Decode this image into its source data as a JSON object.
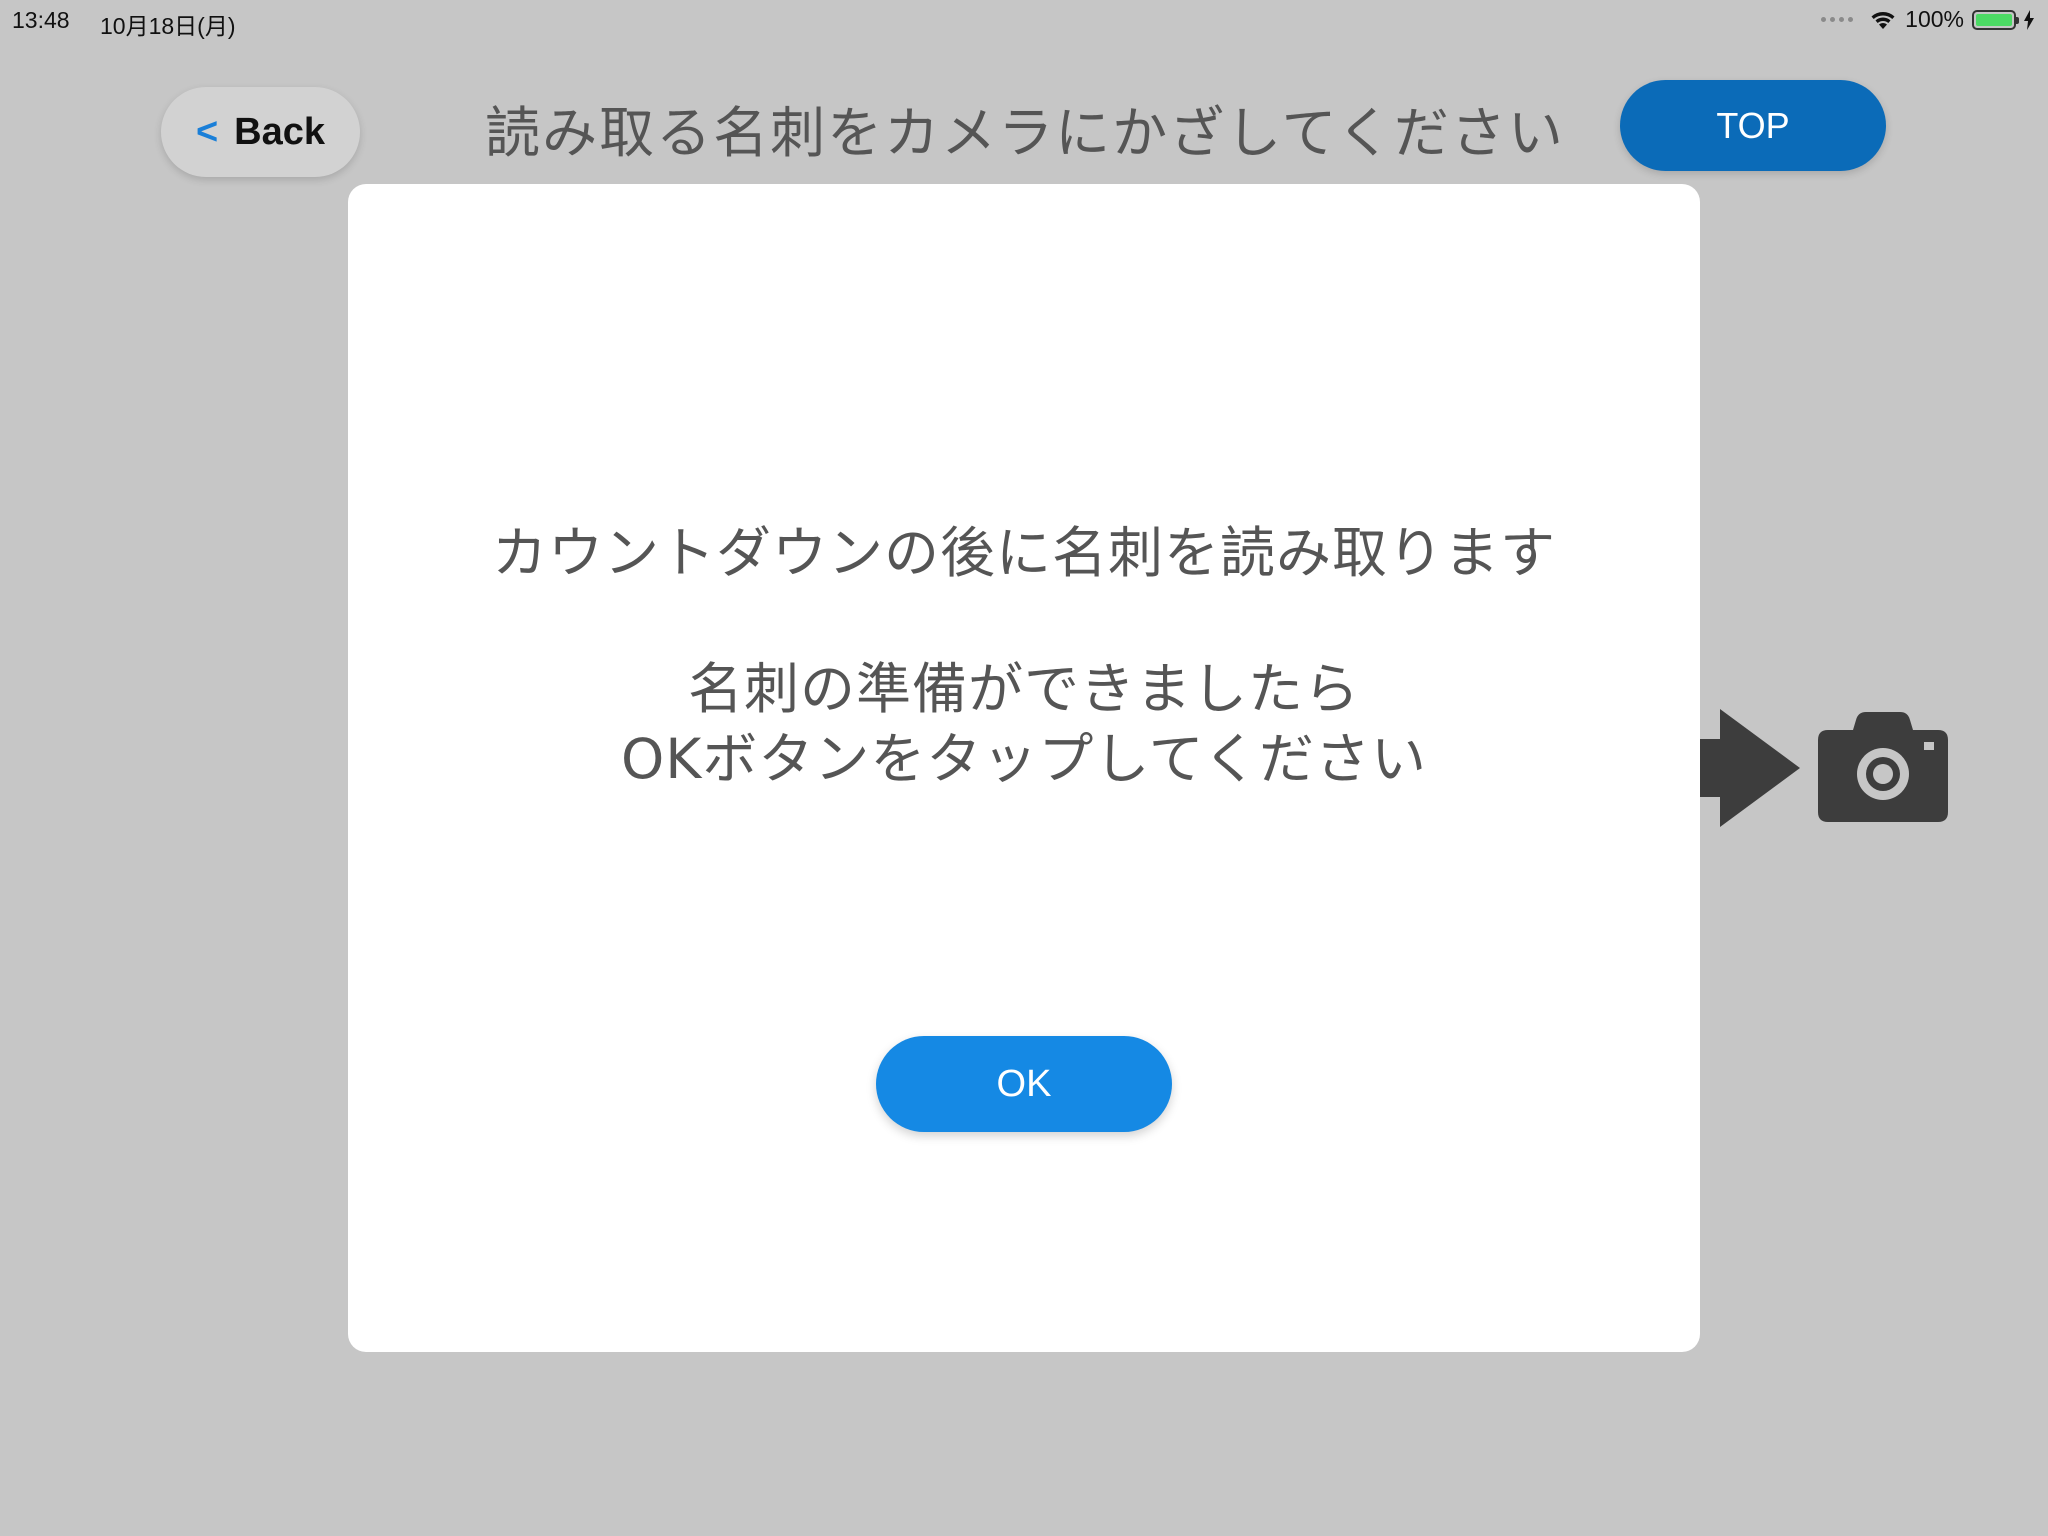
{
  "status_bar": {
    "time": "13:48",
    "date": "10月18日(月)",
    "battery": "100%",
    "battery_fill": 1.0,
    "battery_color": "#4cd964"
  },
  "header": {
    "back_label": "Back",
    "title": "読み取る名刺をカメラにかざしてください",
    "top_label": "TOP"
  },
  "hint_icons": [
    "arrow-right-icon",
    "camera-icon"
  ],
  "dialog": {
    "message": "カウントダウンの後に名刺を読み取ります",
    "instruction_line1": "名刺の準備ができましたら",
    "instruction_line2": "OKボタンをタップしてください",
    "ok_label": "OK"
  },
  "colors": {
    "background": "#c6c6c6",
    "top_button": "#0b6bb8",
    "ok_button": "#1589e4",
    "back_chevron": "#1a7fd8"
  }
}
